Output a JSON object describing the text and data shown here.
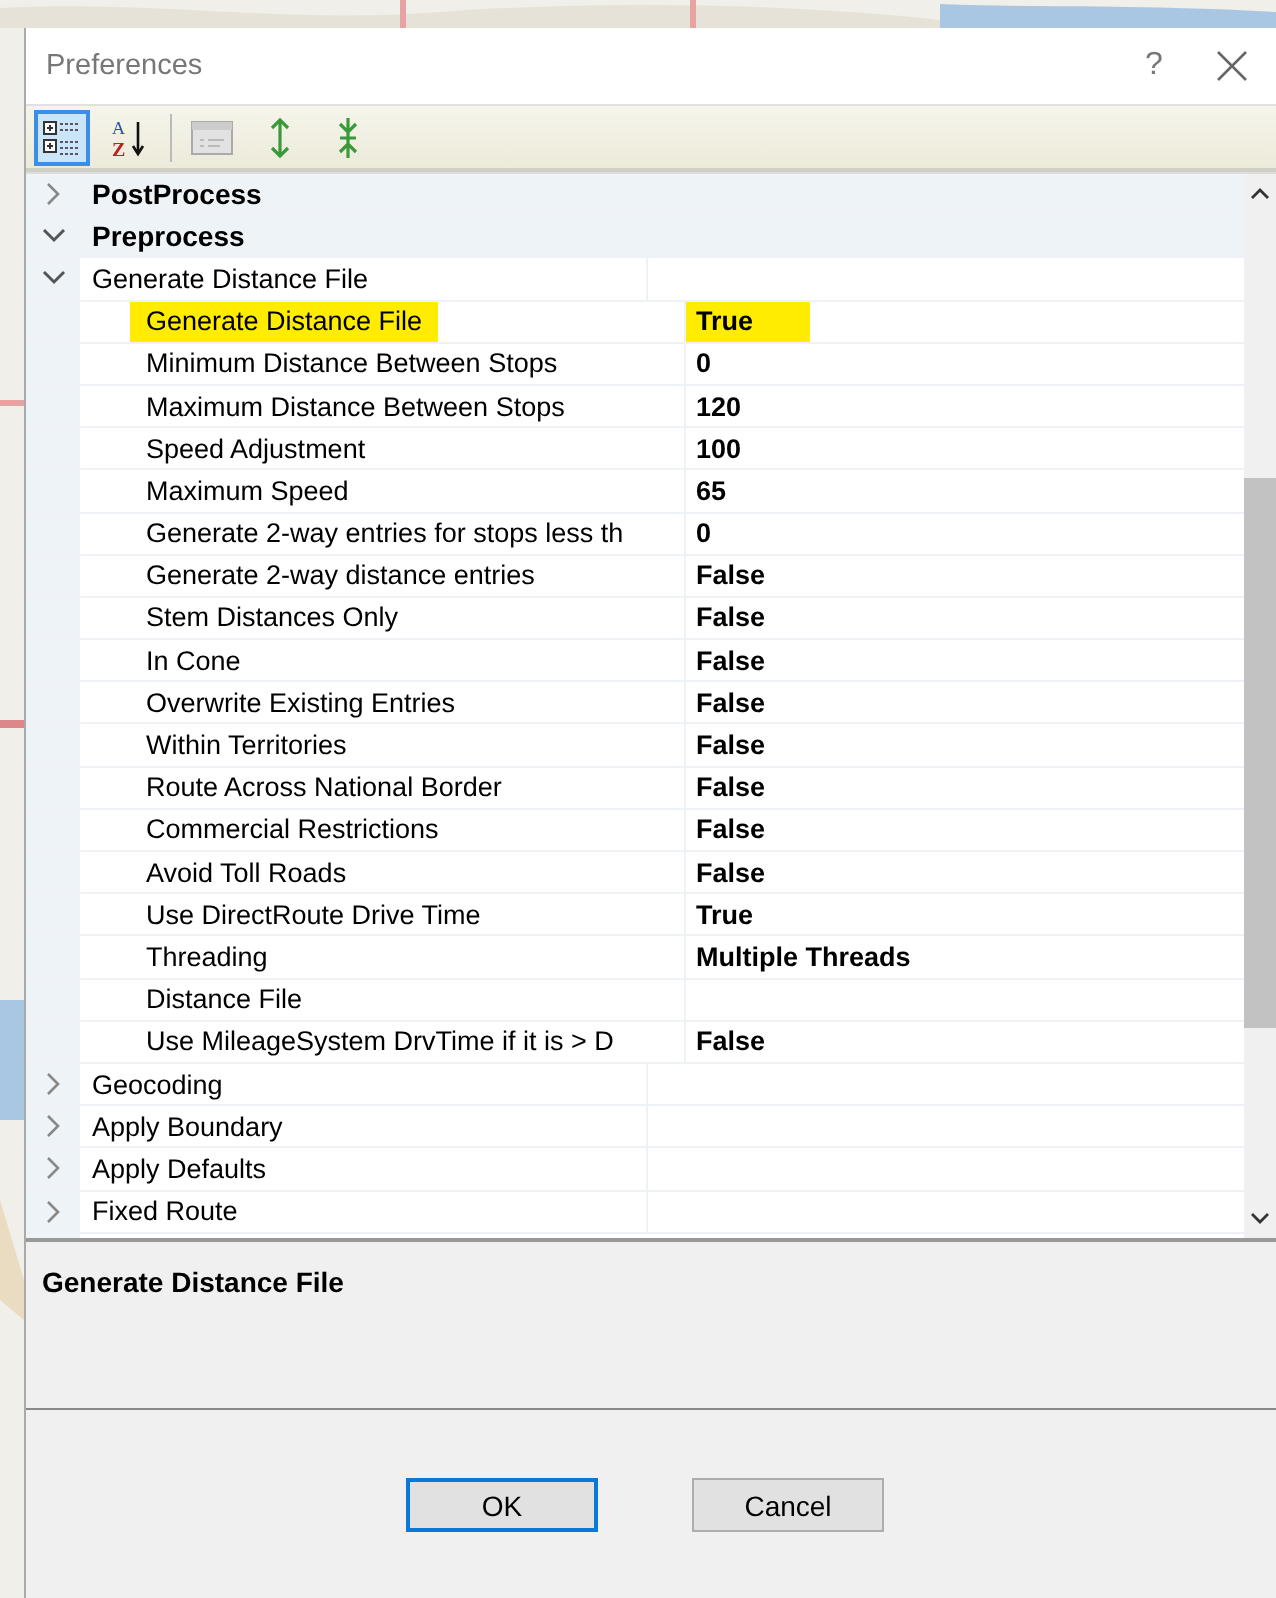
{
  "window": {
    "title": "Preferences",
    "help": "?"
  },
  "toolbar": [
    {
      "kind": "categorized",
      "selected": true
    },
    {
      "kind": "alphabetical",
      "selected": false,
      "glyphs": [
        "A",
        "Z"
      ]
    },
    {
      "kind": "pages",
      "disabled": true
    },
    {
      "kind": "expand"
    },
    {
      "kind": "collapse"
    }
  ],
  "grid": {
    "items": [
      {
        "kind": "category",
        "label": "PostProcess",
        "expanded": false
      },
      {
        "kind": "category",
        "label": "Preprocess",
        "expanded": true,
        "children": [
          {
            "kind": "group",
            "label": "Generate Distance File",
            "expanded": true,
            "children": [
              {
                "label": "Generate Distance File",
                "value": "True",
                "selected": true
              },
              {
                "label": "Minimum Distance Between Stops",
                "value": "0",
                "selected": false
              },
              {
                "label": "Maximum Distance Between Stops",
                "value": "120",
                "selected": false
              },
              {
                "label": "Speed Adjustment",
                "value": "100",
                "selected": false
              },
              {
                "label": "Maximum Speed",
                "value": "65",
                "selected": false
              },
              {
                "label": "Generate 2-way entries for stops less th",
                "value": "0",
                "selected": false
              },
              {
                "label": "Generate 2-way distance entries",
                "value": "False",
                "selected": false
              },
              {
                "label": "Stem Distances Only",
                "value": "False",
                "selected": false
              },
              {
                "label": "In Cone",
                "value": "False",
                "selected": false
              },
              {
                "label": "Overwrite Existing Entries",
                "value": "False",
                "selected": false
              },
              {
                "label": "Within Territories",
                "value": "False",
                "selected": false
              },
              {
                "label": "Route Across National Border",
                "value": "False",
                "selected": false
              },
              {
                "label": "Commercial Restrictions",
                "value": "False",
                "selected": false
              },
              {
                "label": "Avoid Toll Roads",
                "value": "False",
                "selected": false
              },
              {
                "label": "Use DirectRoute Drive Time",
                "value": "True",
                "selected": false
              },
              {
                "label": "Threading",
                "value": "Multiple Threads",
                "selected": false
              },
              {
                "label": "Distance File",
                "selected": false
              },
              {
                "label": "Use MileageSystem DrvTime if it is > D",
                "value": "False",
                "selected": false
              }
            ]
          },
          {
            "kind": "group",
            "label": "Geocoding",
            "expanded": false
          },
          {
            "kind": "group",
            "label": "Apply Boundary",
            "expanded": false
          },
          {
            "kind": "group",
            "label": "Apply Defaults",
            "expanded": false
          },
          {
            "kind": "group",
            "label": "Fixed Route",
            "expanded": false
          }
        ]
      }
    ]
  },
  "description": {
    "title": "Generate Distance File"
  },
  "buttons": [
    {
      "label": "OK",
      "default": true
    },
    {
      "label": "Cancel",
      "default": false
    }
  ]
}
